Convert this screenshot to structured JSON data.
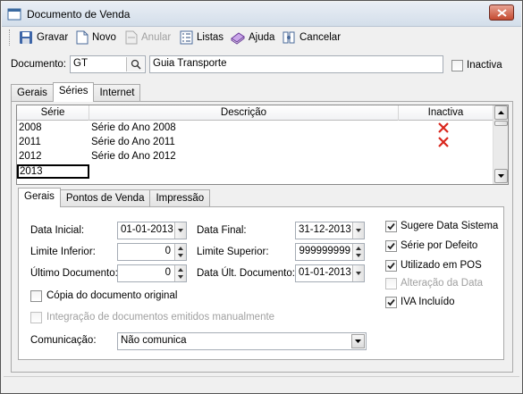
{
  "window": {
    "title": "Documento de Venda"
  },
  "toolbar": {
    "save": "Gravar",
    "new": "Novo",
    "cancel_doc": "Anular",
    "lists": "Listas",
    "help": "Ajuda",
    "close": "Cancelar"
  },
  "document": {
    "label": "Documento:",
    "code": "GT",
    "description": "Guia Transporte",
    "inactive_label": "Inactiva"
  },
  "main_tabs": [
    "Gerais",
    "Séries",
    "Internet"
  ],
  "grid": {
    "headers": [
      "Série",
      "Descrição",
      "Inactiva"
    ],
    "rows": [
      {
        "serie": "2008",
        "descricao": "Série do Ano 2008",
        "inactiva": true
      },
      {
        "serie": "2011",
        "descricao": "Série do Ano 2011",
        "inactiva": true
      },
      {
        "serie": "2012",
        "descricao": "Série do Ano 2012",
        "inactiva": false
      },
      {
        "serie": "2013",
        "descricao": "",
        "inactiva": false
      }
    ]
  },
  "sub_tabs": [
    "Gerais",
    "Pontos de Venda",
    "Impressão"
  ],
  "form": {
    "data_inicial_label": "Data Inicial:",
    "data_inicial": "01-01-2013",
    "data_final_label": "Data Final:",
    "data_final": "31-12-2013",
    "limite_inferior_label": "Limite Inferior:",
    "limite_inferior": "0",
    "limite_superior_label": "Limite Superior:",
    "limite_superior": "999999999",
    "ultimo_doc_label": "Último Documento:",
    "ultimo_doc": "0",
    "data_ult_doc_label": "Data Últ. Documento:",
    "data_ult_doc": "01-01-2013",
    "copia_label": "Cópia do documento original",
    "integracao_label": "Integração de documentos emitidos manualmente",
    "comunicacao_label": "Comunicação:",
    "comunicacao": "Não comunica"
  },
  "options": {
    "sugere_data": "Sugere Data Sistema",
    "serie_defeito": "Série por Defeito",
    "utilizado_pos": "Utilizado em POS",
    "alteracao_data": "Alteração da Data",
    "iva_incluido": "IVA Incluído"
  },
  "colors": {
    "accent_x": "#d9261c",
    "title_bg": "#dbe4ee"
  }
}
